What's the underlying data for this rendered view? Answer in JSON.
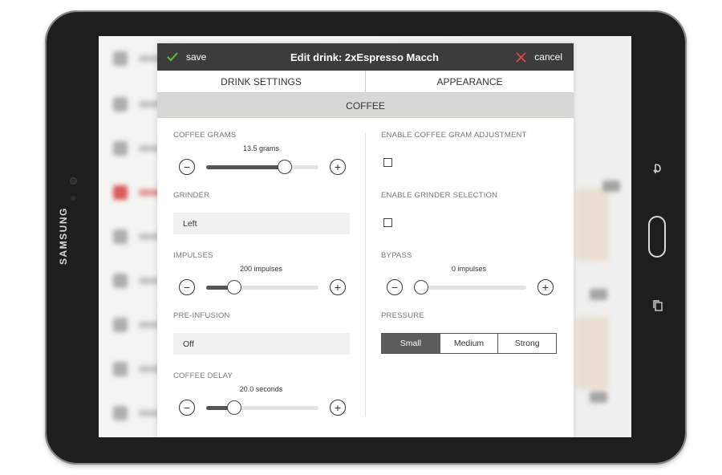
{
  "device": {
    "brand": "SAMSUNG"
  },
  "dialog": {
    "title": "Edit drink: 2xEspresso Macch",
    "save_label": "save",
    "cancel_label": "cancel"
  },
  "tabs": [
    {
      "label": "DRINK SETTINGS",
      "active": true
    },
    {
      "label": "APPEARANCE",
      "active": false
    }
  ],
  "section": {
    "title": "COFFEE"
  },
  "left": {
    "coffee_grams": {
      "label": "COFFEE GRAMS",
      "value_text": "13.5 grams",
      "level": 0.73
    },
    "grinder": {
      "label": "GRINDER",
      "value": "Left"
    },
    "impulses": {
      "label": "IMPULSES",
      "value_text": "200 impulses",
      "level": 0.21
    },
    "pre_infusion": {
      "label": "PRE-INFUSION",
      "value": "Off"
    },
    "coffee_delay": {
      "label": "COFFEE DELAY",
      "value_text": "20.0 seconds",
      "level": 0.21
    }
  },
  "right": {
    "enable_gram_adjustment": {
      "label": "ENABLE COFFEE GRAM ADJUSTMENT",
      "checked": false
    },
    "enable_grinder_selection": {
      "label": "ENABLE GRINDER SELECTION",
      "checked": false
    },
    "bypass": {
      "label": "BYPASS",
      "value_text": "0 impulses",
      "level": 0.0
    },
    "pressure": {
      "label": "PRESSURE",
      "options": [
        "Small",
        "Medium",
        "Strong"
      ],
      "selected": "Small"
    }
  },
  "colors": {
    "header_bg": "#3c3c3c",
    "save_check": "#5fbf3a",
    "cancel_x": "#e04848",
    "section_bg": "#d7d7d4",
    "selected_segment": "#5b5b5b"
  },
  "icons": {
    "save": "check-icon",
    "cancel": "x-icon",
    "decrease": "minus-circle-icon",
    "increase": "plus-circle-icon",
    "android_back": "back-icon",
    "android_recent": "recent-apps-icon"
  }
}
